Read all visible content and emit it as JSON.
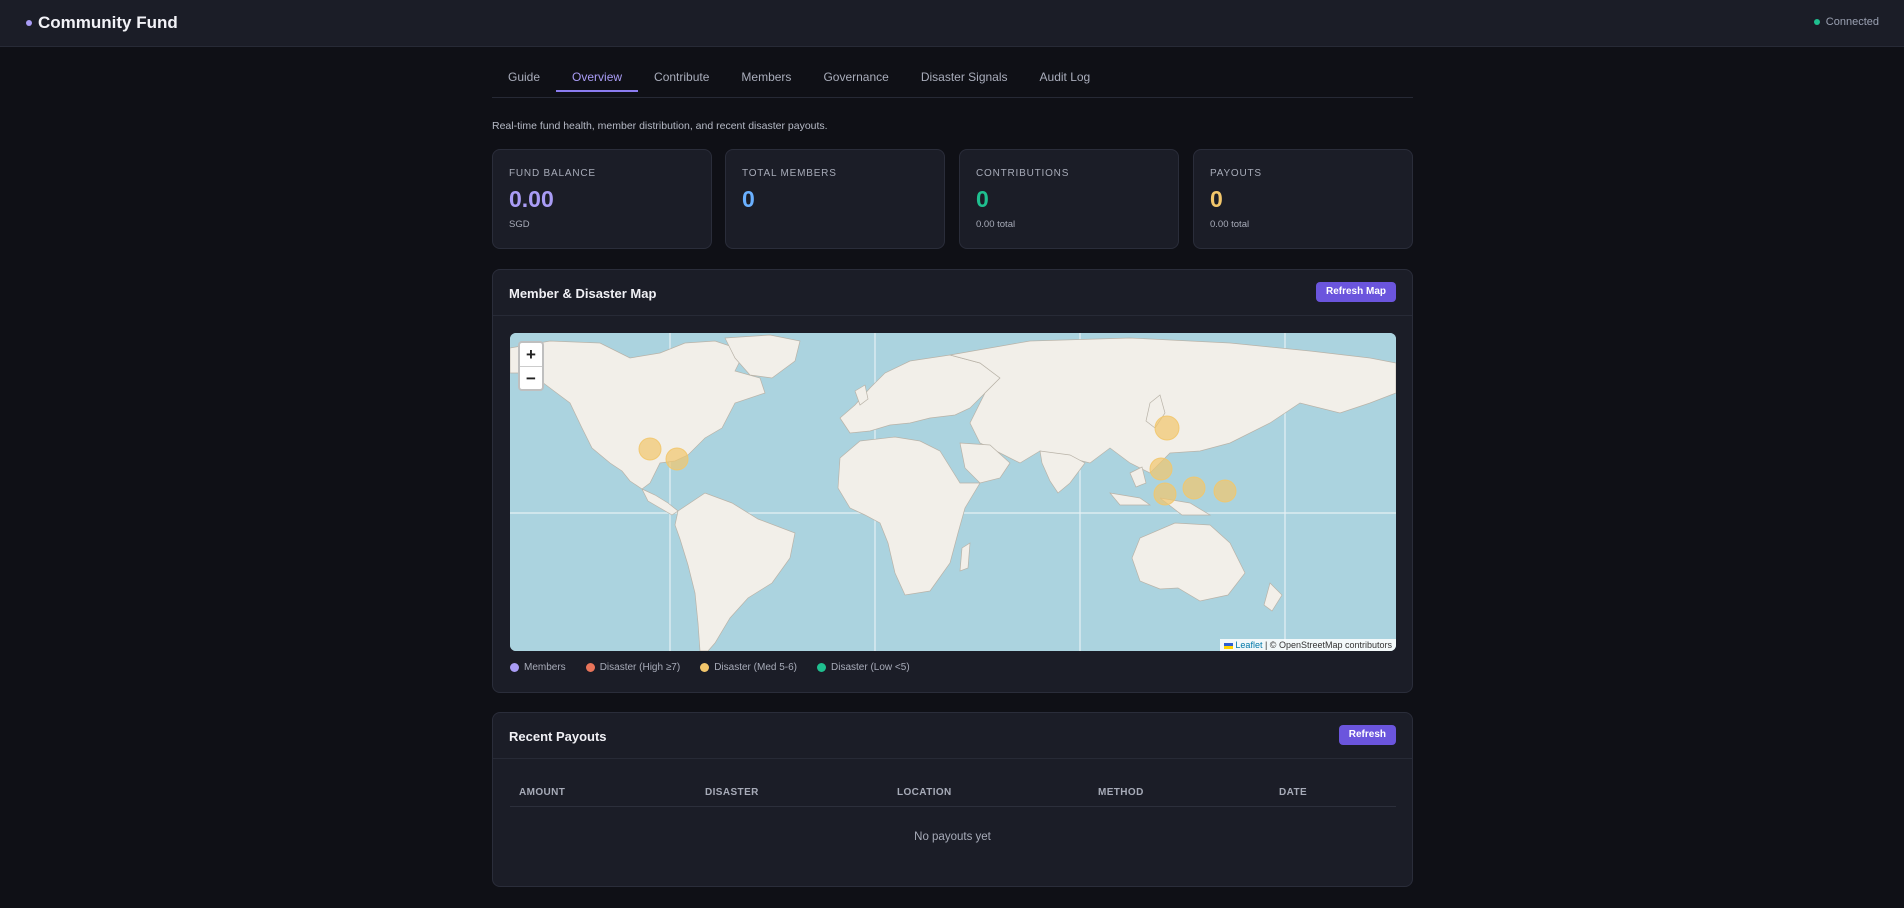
{
  "app": {
    "title": "Community Fund",
    "status": "Connected"
  },
  "tabs": [
    {
      "label": "Guide",
      "active": false
    },
    {
      "label": "Overview",
      "active": true
    },
    {
      "label": "Contribute",
      "active": false
    },
    {
      "label": "Members",
      "active": false
    },
    {
      "label": "Governance",
      "active": false
    },
    {
      "label": "Disaster Signals",
      "active": false
    },
    {
      "label": "Audit Log",
      "active": false
    }
  ],
  "overview": {
    "subtitle": "Real-time fund health, member distribution, and recent disaster payouts."
  },
  "stats": [
    {
      "label": "FUND BALANCE",
      "value": "0.00",
      "sub": "SGD",
      "color": "#a99cf5"
    },
    {
      "label": "TOTAL MEMBERS",
      "value": "0",
      "sub": "",
      "color": "#6ab0ff"
    },
    {
      "label": "CONTRIBUTIONS",
      "value": "0",
      "sub": "0.00 total",
      "color": "#1fbf8f"
    },
    {
      "label": "PAYOUTS",
      "value": "0",
      "sub": "0.00 total",
      "color": "#f2c66b"
    }
  ],
  "map_panel": {
    "title": "Member & Disaster Map",
    "refresh_label": "Refresh Map",
    "zoom_in": "+",
    "zoom_out": "−",
    "attribution_link": "Leaflet",
    "attribution_text": "| © OpenStreetMap contributors",
    "legend": [
      {
        "label": "Members",
        "color": "#a99cf5"
      },
      {
        "label": "Disaster (High ≥7)",
        "color": "#e8745a"
      },
      {
        "label": "Disaster (Med 5-6)",
        "color": "#f2c66b"
      },
      {
        "label": "Disaster (Low <5)",
        "color": "#1fbf8f"
      }
    ]
  },
  "payouts_panel": {
    "title": "Recent Payouts",
    "refresh_label": "Refresh",
    "columns": [
      "AMOUNT",
      "DISASTER",
      "LOCATION",
      "METHOD",
      "DATE"
    ],
    "empty_text": "No payouts yet"
  }
}
